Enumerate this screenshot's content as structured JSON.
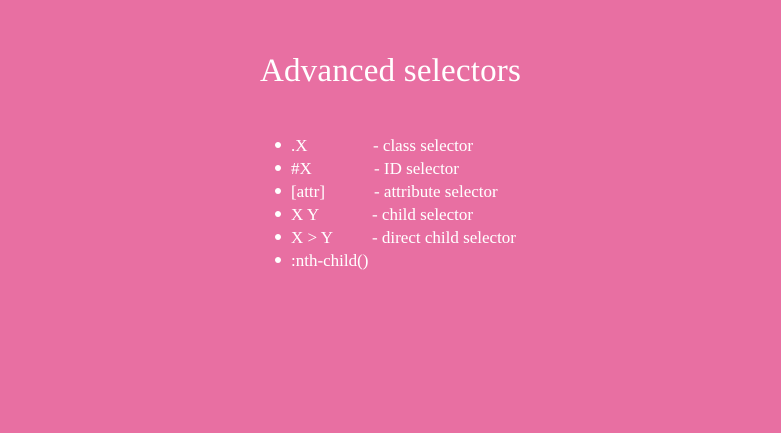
{
  "slide": {
    "title": "Advanced selectors",
    "items": [
      {
        "selector": ".X",
        "description": "- class selector"
      },
      {
        "selector": "#X",
        "description": "- ID selector"
      },
      {
        "selector": "[attr]",
        "description": "- attribute selector"
      },
      {
        "selector": "X Y",
        "description": "- child selector"
      },
      {
        "selector": "X > Y",
        "description": "- direct child selector"
      },
      {
        "selector": ":nth-child()",
        "description": ""
      }
    ]
  },
  "colors": {
    "background": "#e86fa2",
    "text": "#ffffff"
  }
}
